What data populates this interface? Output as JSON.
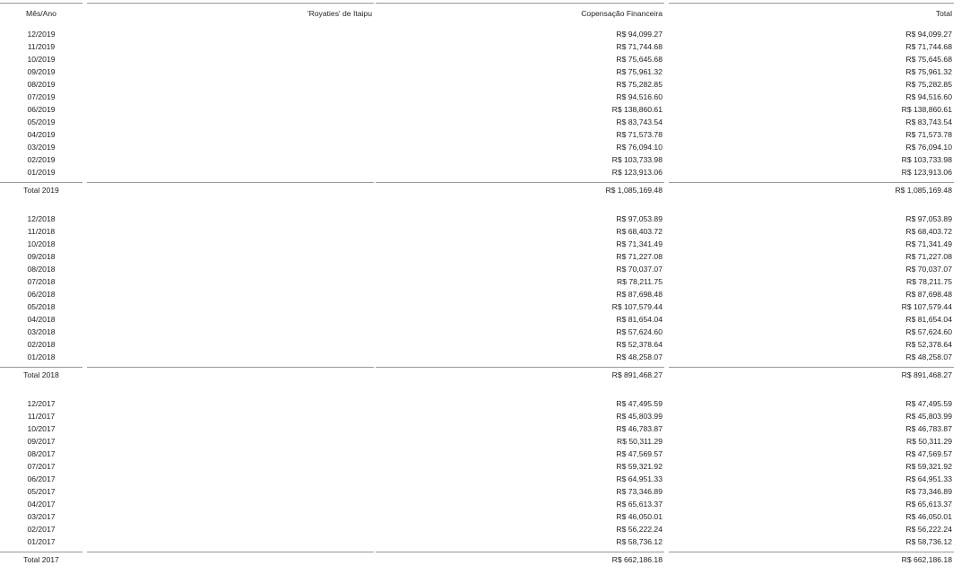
{
  "headers": {
    "mes_ano": "Mês/Ano",
    "royalties": "'Royaties' de Itaipu",
    "compensacao": "Copensação Financeira",
    "total": "Total"
  },
  "groups": [
    {
      "rows": [
        {
          "mes": "12/2019",
          "royalties": "",
          "compensacao": "R$ 94,099.27",
          "total": "R$ 94,099.27"
        },
        {
          "mes": "11/2019",
          "royalties": "",
          "compensacao": "R$ 71,744.68",
          "total": "R$ 71,744.68"
        },
        {
          "mes": "10/2019",
          "royalties": "",
          "compensacao": "R$ 75,645.68",
          "total": "R$ 75,645.68"
        },
        {
          "mes": "09/2019",
          "royalties": "",
          "compensacao": "R$ 75,961.32",
          "total": "R$ 75,961.32"
        },
        {
          "mes": "08/2019",
          "royalties": "",
          "compensacao": "R$ 75,282.85",
          "total": "R$ 75,282.85"
        },
        {
          "mes": "07/2019",
          "royalties": "",
          "compensacao": "R$ 94,516.60",
          "total": "R$ 94,516.60"
        },
        {
          "mes": "06/2019",
          "royalties": "",
          "compensacao": "R$ 138,860.61",
          "total": "R$ 138,860.61"
        },
        {
          "mes": "05/2019",
          "royalties": "",
          "compensacao": "R$ 83,743.54",
          "total": "R$ 83,743.54"
        },
        {
          "mes": "04/2019",
          "royalties": "",
          "compensacao": "R$ 71,573.78",
          "total": "R$ 71,573.78"
        },
        {
          "mes": "03/2019",
          "royalties": "",
          "compensacao": "R$ 76,094.10",
          "total": "R$ 76,094.10"
        },
        {
          "mes": "02/2019",
          "royalties": "",
          "compensacao": "R$ 103,733.98",
          "total": "R$ 103,733.98"
        },
        {
          "mes": "01/2019",
          "royalties": "",
          "compensacao": "R$ 123,913.06",
          "total": "R$ 123,913.06"
        }
      ],
      "total_label": "Total 2019",
      "total_royalties": "",
      "total_compensacao": "R$ 1,085,169.48",
      "total_total": "R$ 1,085,169.48"
    },
    {
      "rows": [
        {
          "mes": "12/2018",
          "royalties": "",
          "compensacao": "R$ 97,053.89",
          "total": "R$ 97,053.89"
        },
        {
          "mes": "11/2018",
          "royalties": "",
          "compensacao": "R$ 68,403.72",
          "total": "R$ 68,403.72"
        },
        {
          "mes": "10/2018",
          "royalties": "",
          "compensacao": "R$ 71,341.49",
          "total": "R$ 71,341.49"
        },
        {
          "mes": "09/2018",
          "royalties": "",
          "compensacao": "R$ 71,227.08",
          "total": "R$ 71,227.08"
        },
        {
          "mes": "08/2018",
          "royalties": "",
          "compensacao": "R$ 70,037.07",
          "total": "R$ 70,037.07"
        },
        {
          "mes": "07/2018",
          "royalties": "",
          "compensacao": "R$ 78,211.75",
          "total": "R$ 78,211.75"
        },
        {
          "mes": "06/2018",
          "royalties": "",
          "compensacao": "R$ 87,698.48",
          "total": "R$ 87,698.48"
        },
        {
          "mes": "05/2018",
          "royalties": "",
          "compensacao": "R$ 107,579.44",
          "total": "R$ 107,579.44"
        },
        {
          "mes": "04/2018",
          "royalties": "",
          "compensacao": "R$ 81,654.04",
          "total": "R$ 81,654.04"
        },
        {
          "mes": "03/2018",
          "royalties": "",
          "compensacao": "R$ 57,624.60",
          "total": "R$ 57,624.60"
        },
        {
          "mes": "02/2018",
          "royalties": "",
          "compensacao": "R$ 52,378.64",
          "total": "R$ 52,378.64"
        },
        {
          "mes": "01/2018",
          "royalties": "",
          "compensacao": "R$ 48,258.07",
          "total": "R$ 48,258.07"
        }
      ],
      "total_label": "Total 2018",
      "total_royalties": "",
      "total_compensacao": "R$ 891,468.27",
      "total_total": "R$ 891,468.27"
    },
    {
      "rows": [
        {
          "mes": "12/2017",
          "royalties": "",
          "compensacao": "R$ 47,495.59",
          "total": "R$ 47,495.59"
        },
        {
          "mes": "11/2017",
          "royalties": "",
          "compensacao": "R$ 45,803.99",
          "total": "R$ 45,803.99"
        },
        {
          "mes": "10/2017",
          "royalties": "",
          "compensacao": "R$ 46,783.87",
          "total": "R$ 46,783.87"
        },
        {
          "mes": "09/2017",
          "royalties": "",
          "compensacao": "R$ 50,311.29",
          "total": "R$ 50,311.29"
        },
        {
          "mes": "08/2017",
          "royalties": "",
          "compensacao": "R$ 47,569.57",
          "total": "R$ 47,569.57"
        },
        {
          "mes": "07/2017",
          "royalties": "",
          "compensacao": "R$ 59,321.92",
          "total": "R$ 59,321.92"
        },
        {
          "mes": "06/2017",
          "royalties": "",
          "compensacao": "R$ 64,951.33",
          "total": "R$ 64,951.33"
        },
        {
          "mes": "05/2017",
          "royalties": "",
          "compensacao": "R$ 73,346.89",
          "total": "R$ 73,346.89"
        },
        {
          "mes": "04/2017",
          "royalties": "",
          "compensacao": "R$ 65,613.37",
          "total": "R$ 65,613.37"
        },
        {
          "mes": "03/2017",
          "royalties": "",
          "compensacao": "R$ 46,050.01",
          "total": "R$ 46,050.01"
        },
        {
          "mes": "02/2017",
          "royalties": "",
          "compensacao": "R$ 56,222.24",
          "total": "R$ 56,222.24"
        },
        {
          "mes": "01/2017",
          "royalties": "",
          "compensacao": "R$ 58,736.12",
          "total": "R$ 58,736.12"
        }
      ],
      "total_label": "Total 2017",
      "total_royalties": "",
      "total_compensacao": "R$ 662,186.18",
      "total_total": "R$ 662,186.18"
    }
  ]
}
